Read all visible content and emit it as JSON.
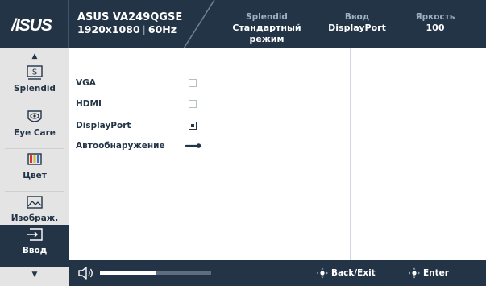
{
  "header": {
    "brand": "/ISUS",
    "model": "ASUS VA249QGSE",
    "resolution": "1920x1080",
    "refresh": "60Hz",
    "stats": [
      {
        "key": "Splendid",
        "value": "Стандартный режим"
      },
      {
        "key": "Ввод",
        "value": "DisplayPort"
      },
      {
        "key": "Яркость",
        "value": "100"
      }
    ]
  },
  "sidebar": {
    "items": [
      {
        "label": "Splendid",
        "icon": "splendid-icon"
      },
      {
        "label": "Eye Care",
        "icon": "eye-icon"
      },
      {
        "label": "Цвет",
        "icon": "color-bars-icon"
      },
      {
        "label": "Изображ.",
        "icon": "image-icon"
      },
      {
        "label": "Ввод",
        "icon": "input-icon",
        "active": true
      }
    ]
  },
  "input_menu": {
    "options": [
      {
        "label": "VGA",
        "state": "unchecked"
      },
      {
        "label": "HDMI",
        "state": "unchecked"
      },
      {
        "label": "DisplayPort",
        "state": "checked"
      },
      {
        "label": "Автообнаружение",
        "state": "toggle-on"
      }
    ]
  },
  "footer": {
    "volume_fraction": 0.5,
    "back_label": "Back/Exit",
    "enter_label": "Enter"
  },
  "colors": {
    "bar": "#233447",
    "sidebar_bg": "#e4e4e4",
    "muted": "#9fb0c2"
  }
}
